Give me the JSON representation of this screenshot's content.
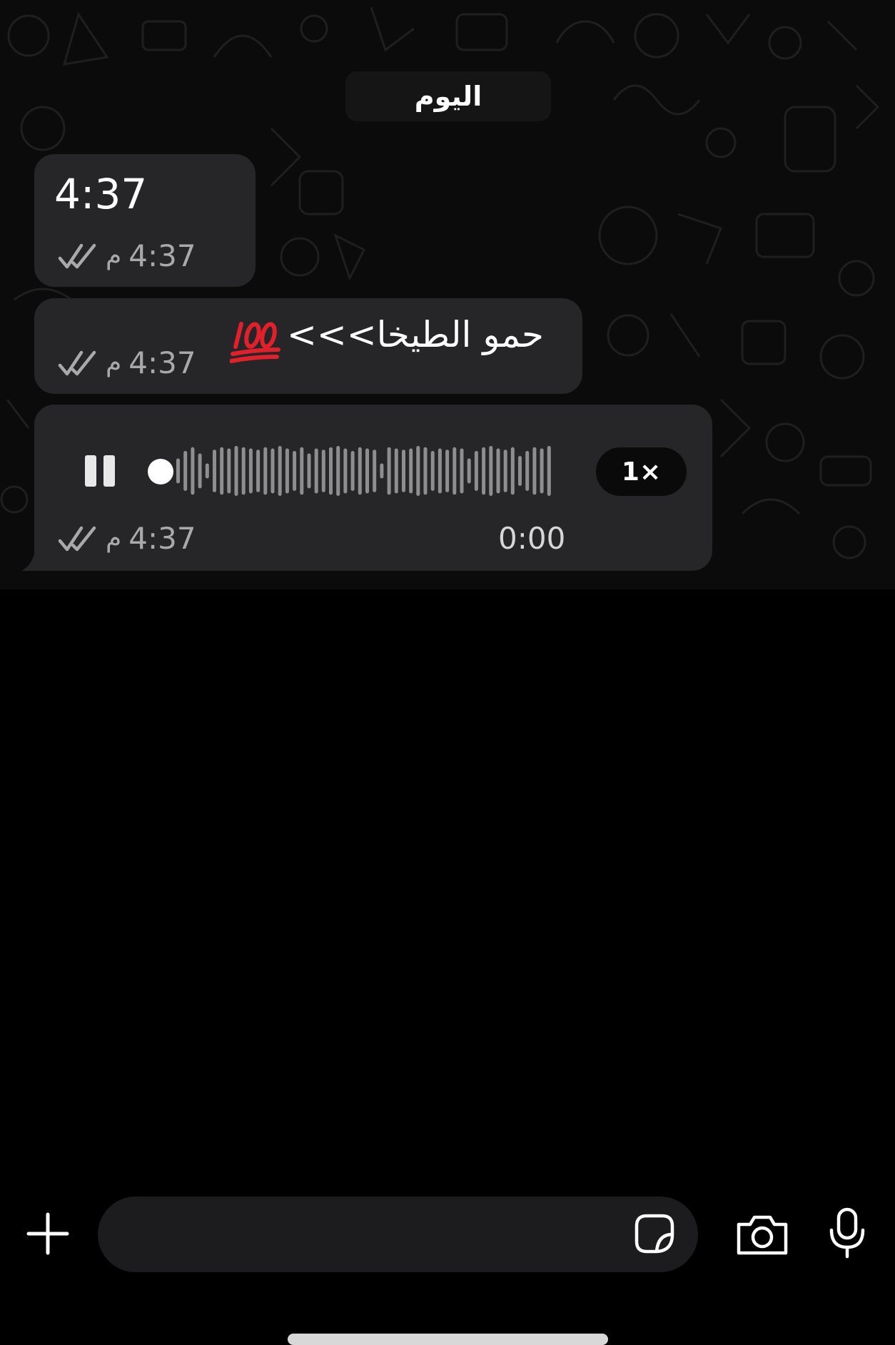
{
  "chat": {
    "date_separator": "اليوم",
    "messages": [
      {
        "type": "text",
        "text": "4:37",
        "time": "4:37",
        "ampm": "م",
        "status": "read-double-tick"
      },
      {
        "type": "text",
        "text": "حمو الطيخا>>>",
        "emoji": "💯",
        "time": "4:37",
        "ampm": "م",
        "status": "read-double-tick"
      },
      {
        "type": "voice",
        "duration": "0:00",
        "playback_speed": "1×",
        "state": "playing",
        "time": "4:37",
        "ampm": "م",
        "status": "read-double-tick"
      }
    ]
  },
  "composer": {
    "input_value": "",
    "icons": [
      "plus-icon",
      "sticker-icon",
      "camera-icon",
      "microphone-icon"
    ]
  },
  "colors": {
    "bubble": "#262628",
    "background": "#0b0b0b",
    "meta_text": "#a9a9ab"
  }
}
